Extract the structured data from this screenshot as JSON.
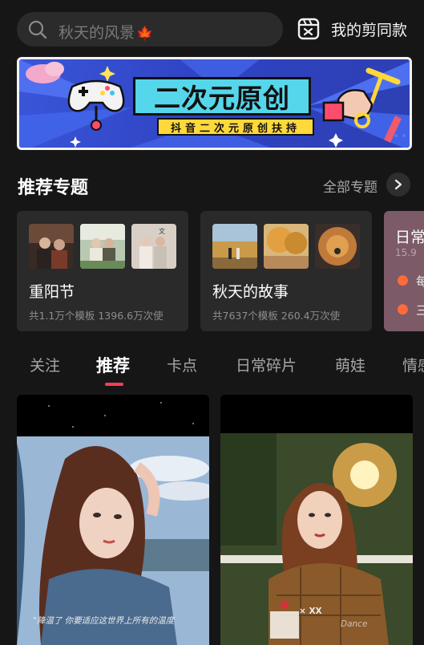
{
  "search": {
    "placeholder": "秋天的风景",
    "leaf_icon": "maple-leaf-icon",
    "icon": "search-icon"
  },
  "my_templates": {
    "label": "我的剪同款",
    "icon": "template-clip-icon"
  },
  "banner": {
    "headline": "二次元原创",
    "subline": "抖音二次元原创扶持",
    "colors": {
      "background": "#3a56d8",
      "headline_bg": "#55d6ea",
      "subline_bg": "#ffd83a"
    }
  },
  "featured": {
    "title": "推荐专题",
    "all_label": "全部专题",
    "cards": [
      {
        "name": "重阳节",
        "meta": "共1.1万个模板 1396.6万次使"
      },
      {
        "name": "秋天的故事",
        "meta": "共7637个模板 260.4万次使"
      },
      {
        "name": "日常",
        "meta": "15.9",
        "hot1": "每",
        "hot2": "三"
      }
    ]
  },
  "tabs": [
    {
      "label": "关注"
    },
    {
      "label": "推荐"
    },
    {
      "label": "卡点"
    },
    {
      "label": "日常碎片"
    },
    {
      "label": "萌娃"
    },
    {
      "label": "情感"
    }
  ],
  "active_tab": "推荐",
  "accent_color": "#ff3b56",
  "feed": [
    {
      "caption": "\"降温了 你要适应这世界上所有的温度"
    },
    {
      "caption": "× XX",
      "watermark": "Dance"
    }
  ]
}
